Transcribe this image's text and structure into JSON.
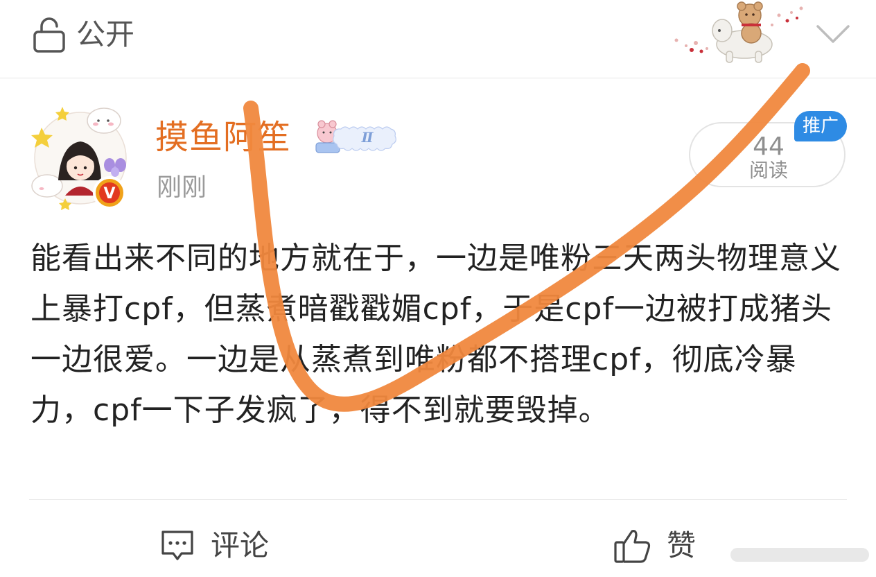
{
  "header": {
    "privacy_label": "公开",
    "icons": {
      "privacy": "lock-icon",
      "expand": "chevron-down-icon",
      "sticker": "bear-horse-sticker"
    }
  },
  "post": {
    "author_name": "摸鱼阿笙",
    "author_badge_text": "Ⅱ",
    "time": "刚刚",
    "read_count": "44",
    "read_label": "阅读",
    "promo_label": "推广",
    "verified_mark": "V",
    "body": "能看出来不同的地方就在于，一边是唯粉三天两头物理意义上暴打cpf，但蒸煮暗戳戳媚cpf，于是cpf一边被打成猪头一边很爱。一边是从蒸煮到唯粉都不搭理cpf，彻底冷暴力，cpf一下子发疯了，得不到就要毁掉。"
  },
  "actions": {
    "comment_label": "评论",
    "like_label": "赞",
    "icons": {
      "comment": "comment-icon",
      "like": "thumbs-up-icon"
    }
  },
  "colors": {
    "author_name": "#e36e22",
    "annotation_stroke": "#f0883e",
    "promo_badge": "#2e8be4",
    "verified_badge": "#f0a21a"
  }
}
